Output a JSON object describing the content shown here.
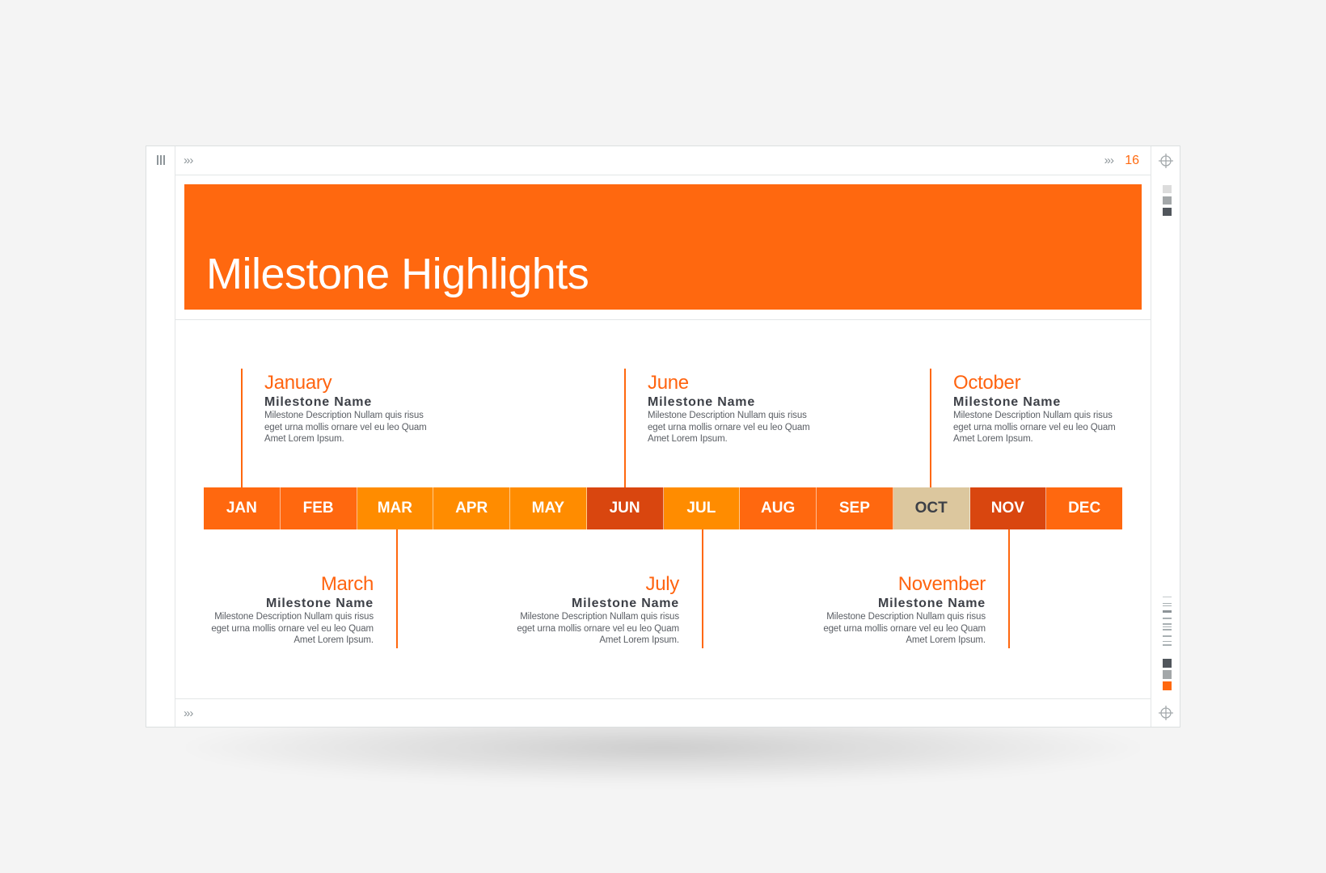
{
  "slide": {
    "page_number": "16",
    "title": "Milestone Highlights"
  },
  "colors": {
    "accent": "#ff680f",
    "light_orange": "#ff8c00",
    "dark_orange": "#d9460f",
    "tan": "#dcc79e",
    "text_dark": "#3d4047"
  },
  "toolbar": {
    "menu_icon": "menu-icon",
    "top_chevron_left": "»›",
    "top_chevron_right": "»›",
    "bottom_chevron": "»›"
  },
  "side_palette": {
    "top_swatches": [
      "#dcdcdc",
      "#a3a7a9",
      "#51565c"
    ],
    "bottom_swatches": [
      "#51565c",
      "#a3a7a9",
      "#ff680f"
    ]
  },
  "timeline": {
    "months": [
      {
        "label": "JAN",
        "color": "#ff680f",
        "text_color": "#ffffff"
      },
      {
        "label": "FEB",
        "color": "#ff680f",
        "text_color": "#ffffff"
      },
      {
        "label": "MAR",
        "color": "#ff8c00",
        "text_color": "#ffffff"
      },
      {
        "label": "APR",
        "color": "#ff8c00",
        "text_color": "#ffffff"
      },
      {
        "label": "MAY",
        "color": "#ff8c00",
        "text_color": "#ffffff"
      },
      {
        "label": "JUN",
        "color": "#d9460f",
        "text_color": "#ffffff"
      },
      {
        "label": "JUL",
        "color": "#ff8c00",
        "text_color": "#ffffff"
      },
      {
        "label": "AUG",
        "color": "#ff680f",
        "text_color": "#ffffff"
      },
      {
        "label": "SEP",
        "color": "#ff680f",
        "text_color": "#ffffff"
      },
      {
        "label": "OCT",
        "color": "#dcc79e",
        "text_color": "#3d4047"
      },
      {
        "label": "NOV",
        "color": "#d9460f",
        "text_color": "#ffffff"
      },
      {
        "label": "DEC",
        "color": "#ff680f",
        "text_color": "#ffffff"
      }
    ]
  },
  "milestones": [
    {
      "month": "January",
      "name": "Milestone Name",
      "desc1": "Milestone Description Nullam quis risus",
      "desc2": "eget urna mollis ornare vel eu leo Quam",
      "desc3": "Amet Lorem Ipsum.",
      "position": "top",
      "month_index": 0
    },
    {
      "month": "June",
      "name": "Milestone Name",
      "desc1": "Milestone Description Nullam quis risus",
      "desc2": "eget urna mollis ornare vel eu leo Quam",
      "desc3": "Amet Lorem Ipsum.",
      "position": "top",
      "month_index": 5
    },
    {
      "month": "October",
      "name": "Milestone Name",
      "desc1": "Milestone Description Nullam quis risus",
      "desc2": "eget urna mollis ornare vel eu leo Quam",
      "desc3": "Amet Lorem Ipsum.",
      "position": "top",
      "month_index": 9
    },
    {
      "month": "March",
      "name": "Milestone Name",
      "desc1": "Milestone Description Nullam quis risus",
      "desc2": "eget urna mollis ornare vel eu leo Quam",
      "desc3": "Amet Lorem Ipsum.",
      "position": "bottom",
      "month_index": 2
    },
    {
      "month": "July",
      "name": "Milestone Name",
      "desc1": "Milestone Description Nullam quis risus",
      "desc2": "eget urna mollis ornare vel eu leo Quam",
      "desc3": "Amet Lorem Ipsum.",
      "position": "bottom",
      "month_index": 6
    },
    {
      "month": "November",
      "name": "Milestone Name",
      "desc1": "Milestone Description Nullam quis risus",
      "desc2": "eget urna mollis ornare vel eu leo Quam",
      "desc3": "Amet Lorem Ipsum.",
      "position": "bottom",
      "month_index": 10
    }
  ]
}
